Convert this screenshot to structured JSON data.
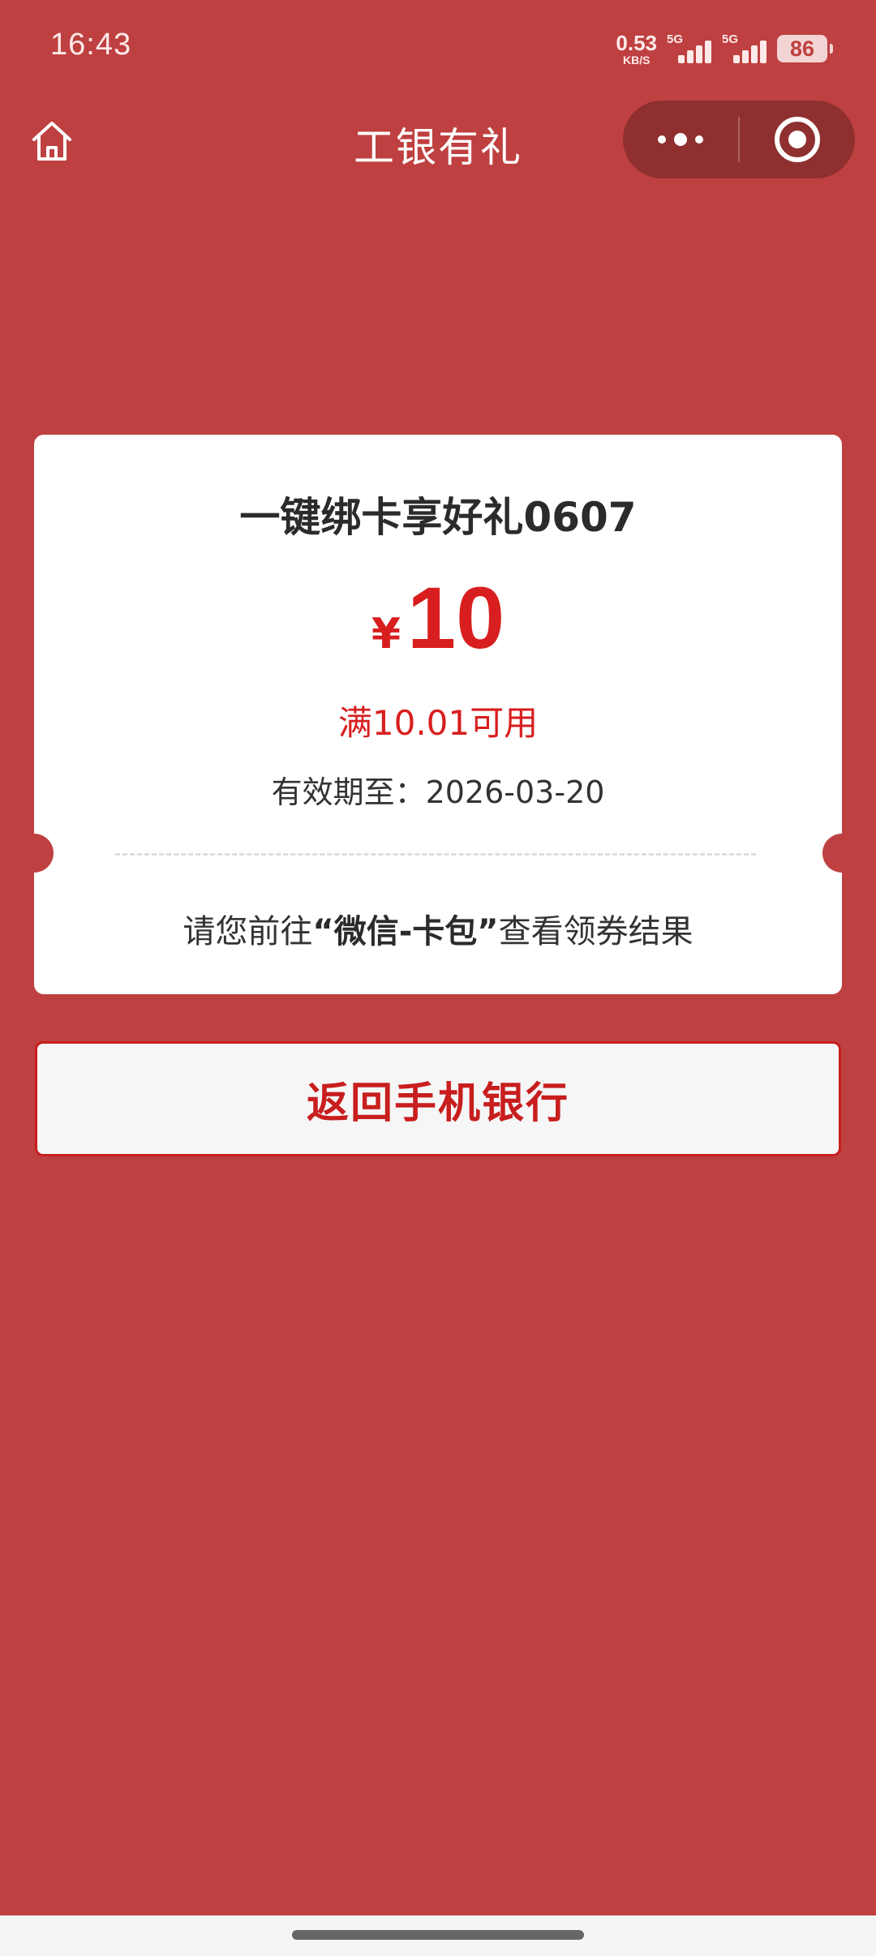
{
  "status_bar": {
    "time": "16:43",
    "net_speed_value": "0.53",
    "net_speed_unit": "KB/S",
    "signal_1": "5G",
    "signal_2": "5G",
    "battery": "86"
  },
  "nav": {
    "title": "工银有礼",
    "home_icon": "home-icon",
    "more_icon": "more-dots-icon",
    "close_icon": "close-target-icon"
  },
  "coupon": {
    "title": "一键绑卡享好礼0607",
    "currency": "¥",
    "amount": "10",
    "condition": "满10.01可用",
    "validity": "有效期至：2026-03-20",
    "hint_prefix": "请您前往",
    "hint_bold": "“微信-卡包”",
    "hint_suffix": "查看领券结果"
  },
  "actions": {
    "return_label": "返回手机银行"
  },
  "colors": {
    "background": "#bf4040",
    "accent_red": "#d81e1e",
    "card": "#ffffff",
    "capsule": "#8f2f2f"
  }
}
